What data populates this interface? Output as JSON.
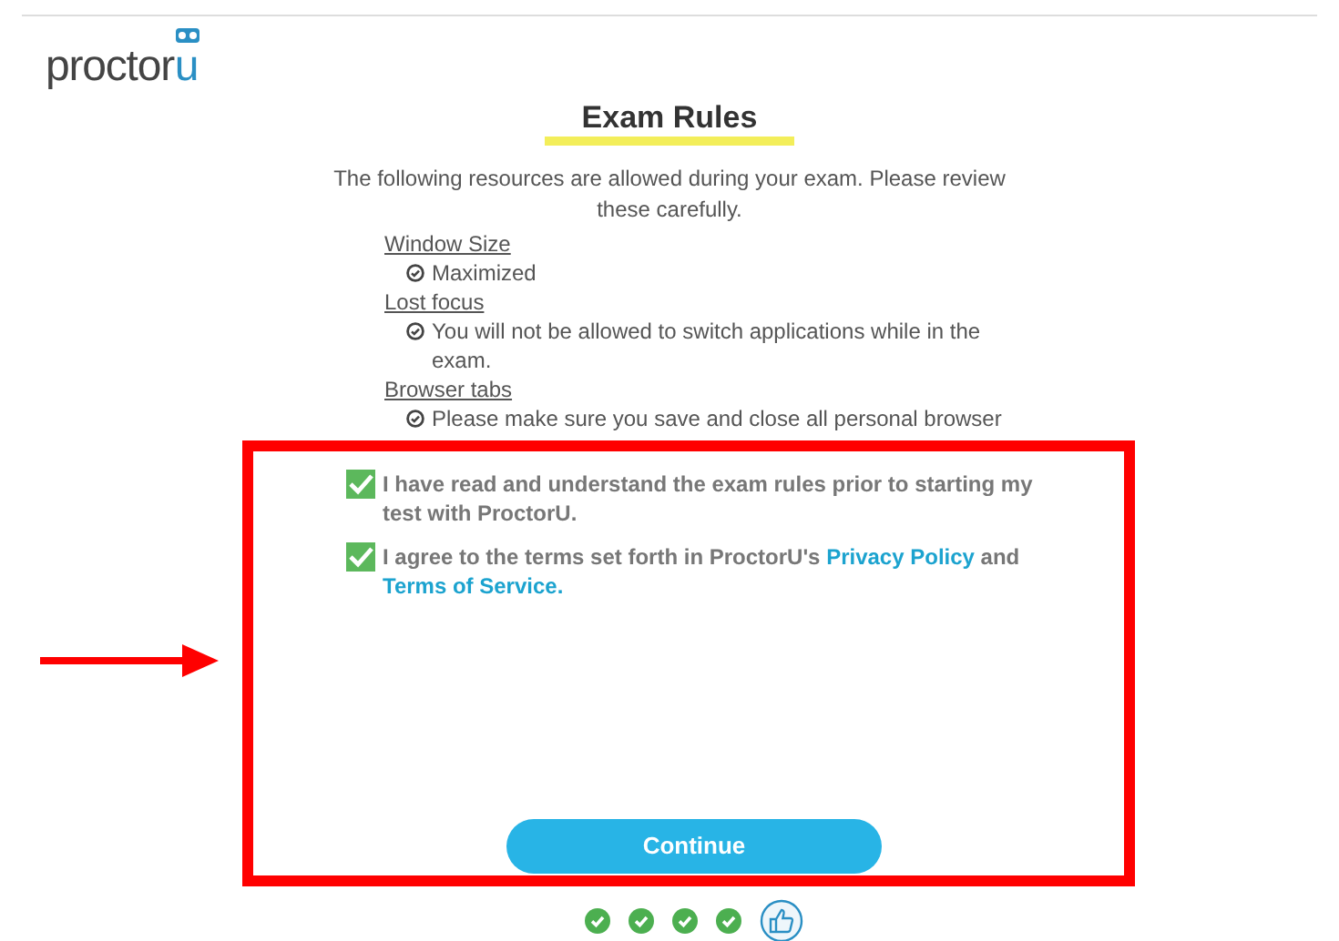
{
  "logo": {
    "text": "proctor",
    "letter": "u"
  },
  "title": "Exam Rules",
  "intro": "The following resources are allowed during your exam. Please review these carefully.",
  "rules": [
    {
      "heading": "Window Size",
      "text": "Maximized"
    },
    {
      "heading": "Lost focus",
      "text": "You will not be allowed to switch applications while in the exam."
    },
    {
      "heading": "Browser tabs",
      "text": "Please make sure you save and close all personal browser"
    }
  ],
  "agreements": [
    {
      "checked": true,
      "parts": [
        {
          "kind": "text",
          "text": "I have read and understand the exam rules prior to starting my test with ProctorU."
        }
      ]
    },
    {
      "checked": true,
      "parts": [
        {
          "kind": "text",
          "text": "I agree to the terms set forth in ProctorU's "
        },
        {
          "kind": "link",
          "text": "Privacy Policy"
        },
        {
          "kind": "text",
          "text": " and "
        },
        {
          "kind": "link",
          "text": "Terms of Service."
        }
      ]
    }
  ],
  "continue_button": "Continue",
  "steps": [
    {
      "kind": "done"
    },
    {
      "kind": "done"
    },
    {
      "kind": "done"
    },
    {
      "kind": "done"
    },
    {
      "kind": "current"
    }
  ]
}
